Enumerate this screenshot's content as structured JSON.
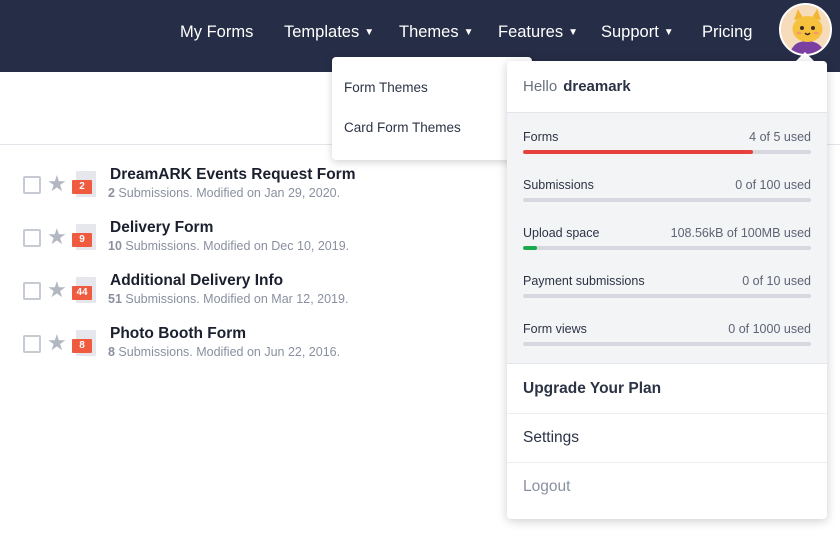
{
  "nav": {
    "items": [
      {
        "label": "My Forms",
        "caret": ""
      },
      {
        "label": "Templates",
        "caret": "▼"
      },
      {
        "label": "Themes",
        "caret": "▼"
      },
      {
        "label": "Features",
        "caret": "▼"
      },
      {
        "label": "Support",
        "caret": "▼"
      },
      {
        "label": "Pricing",
        "caret": ""
      }
    ],
    "bg_color": "#262d46"
  },
  "themes_menu": {
    "items": [
      "Form Themes",
      "Card Form Themes"
    ]
  },
  "forms": [
    {
      "title": "DreamARK Events Request Form",
      "count": "2",
      "meta_count": "2",
      "meta_text": " Submissions. Modified on Jan 29, 2020."
    },
    {
      "title": "Delivery Form",
      "count": "9",
      "meta_count": "10",
      "meta_text": " Submissions. Modified on Dec 10, 2019."
    },
    {
      "title": "Additional Delivery Info",
      "count": "44",
      "meta_count": "51",
      "meta_text": " Submissions. Modified on Mar 12, 2019."
    },
    {
      "title": "Photo Booth Form",
      "count": "8",
      "meta_count": "8",
      "meta_text": " Submissions. Modified on Jun 22, 2016."
    }
  ],
  "user_menu": {
    "hello": "Hello",
    "username": "dreamark",
    "usage": [
      {
        "label": "Forms",
        "value": "4 of 5 used",
        "fill": 0.8,
        "color": "#e8413b"
      },
      {
        "label": "Submissions",
        "value": "0 of 100 used",
        "fill": 0,
        "color": "#1fa94e"
      },
      {
        "label": "Upload space",
        "value": "108.56kB of 100MB used",
        "fill": 0.05,
        "color": "#1fa94e"
      },
      {
        "label": "Payment submissions",
        "value": "0 of 10 used",
        "fill": 0,
        "color": "#1fa94e"
      },
      {
        "label": "Form views",
        "value": "0 of 1000 used",
        "fill": 0,
        "color": "#1fa94e"
      }
    ],
    "links": [
      {
        "label": "Upgrade Your Plan",
        "color": "#2c3345",
        "bold": true
      },
      {
        "label": "Settings",
        "color": "#2c3345",
        "bold": false
      },
      {
        "label": "Logout",
        "color": "#8a90a0",
        "bold": false
      }
    ]
  },
  "icons": {
    "star": "star-icon",
    "caret": "caret-down-icon",
    "avatar": "cat-avatar-icon",
    "form": "form-document-icon"
  }
}
